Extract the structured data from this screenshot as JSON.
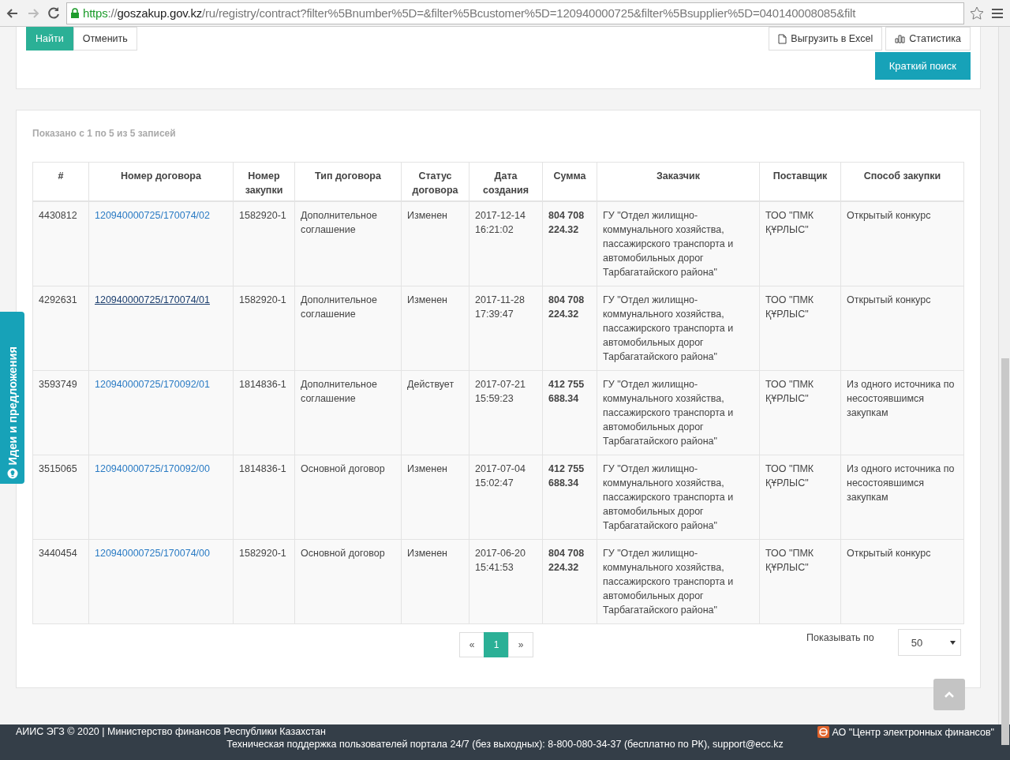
{
  "browser": {
    "url_scheme": "https",
    "url_separator": "://",
    "url_host": "goszakup.gov.kz",
    "url_path": "/ru/registry/contract?filter%5Bnumber%5D=&filter%5Bcustomer%5D=120940000725&filter%5Bsupplier%5D=040140008085&filt"
  },
  "filter_panel": {
    "buttons": [
      {
        "label": "Найти",
        "kind": "primary"
      },
      {
        "label": "Отменить",
        "kind": "default"
      }
    ],
    "right_buttons": [
      {
        "label": "Выгрузить в Excel",
        "kind": "export"
      },
      {
        "label": "Статистика",
        "kind": "stats"
      }
    ],
    "toggle_button": "Краткий поиск"
  },
  "side_tab": {
    "label": "Идеи и предложения"
  },
  "results": {
    "summary": "Показано с 1 по 5 из 5 записей",
    "columns": [
      "#",
      "Номер договора",
      "Номер закупки",
      "Тип договора",
      "Статус договора",
      "Дата создания",
      "Сумма",
      "Заказчик",
      "Поставщик",
      "Способ закупки"
    ],
    "rows": [
      {
        "id": "4430812",
        "contract": "120940000725/170074/02",
        "hovered": false,
        "purchase": "1582920-1",
        "type": "Дополнительное соглашение",
        "status": "Изменен",
        "date": "2017-12-14 16:21:02",
        "sum": "804 708 224.32",
        "customer": "ГУ \"Отдел жилищно-коммунального хозяйства, пассажирского транспорта и автомобильных дорог Тарбагатайского района\"",
        "supplier": "ТОО \"ПМК ҚҰРЛЫС\"",
        "method": "Открытый конкурс"
      },
      {
        "id": "4292631",
        "contract": "120940000725/170074/01",
        "hovered": true,
        "purchase": "1582920-1",
        "type": "Дополнительное соглашение",
        "status": "Изменен",
        "date": "2017-11-28 17:39:47",
        "sum": "804 708 224.32",
        "customer": "ГУ \"Отдел жилищно-коммунального хозяйства, пассажирского транспорта и автомобильных дорог Тарбагатайского района\"",
        "supplier": "ТОО \"ПМК ҚҰРЛЫС\"",
        "method": "Открытый конкурс"
      },
      {
        "id": "3593749",
        "contract": "120940000725/170092/01",
        "hovered": false,
        "purchase": "1814836-1",
        "type": "Дополнительное соглашение",
        "status": "Действует",
        "date": "2017-07-21 15:59:23",
        "sum": "412 755 688.34",
        "customer": "ГУ \"Отдел жилищно-коммунального хозяйства, пассажирского транспорта и автомобильных дорог Тарбагатайского района\"",
        "supplier": "ТОО \"ПМК ҚҰРЛЫС\"",
        "method": "Из одного источника по несостоявшимся закупкам"
      },
      {
        "id": "3515065",
        "contract": "120940000725/170092/00",
        "hovered": false,
        "purchase": "1814836-1",
        "type": "Основной договор",
        "status": "Изменен",
        "date": "2017-07-04 15:02:47",
        "sum": "412 755 688.34",
        "customer": "ГУ \"Отдел жилищно-коммунального хозяйства, пассажирского транспорта и автомобильных дорог Тарбагатайского района\"",
        "supplier": "ТОО \"ПМК ҚҰРЛЫС\"",
        "method": "Из одного источника по несостоявшимся закупкам"
      },
      {
        "id": "3440454",
        "contract": "120940000725/170074/00",
        "hovered": false,
        "purchase": "1582920-1",
        "type": "Основной договор",
        "status": "Изменен",
        "date": "2017-06-20 15:41:53",
        "sum": "804 708 224.32",
        "customer": "ГУ \"Отдел жилищно-коммунального хозяйства, пассажирского транспорта и автомобильных дорог Тарбагатайского района\"",
        "supplier": "ТОО \"ПМК ҚҰРЛЫС\"",
        "method": "Открытый конкурс"
      }
    ],
    "pagination": [
      {
        "label": "«",
        "selected": false
      },
      {
        "label": "1",
        "selected": true
      },
      {
        "label": "»",
        "selected": false
      }
    ],
    "page_size_label": "Показывать по",
    "page_size": "50"
  },
  "footer": {
    "left": "АИИС ЭГЗ © 2020 | Министерство финансов Республики Казахстан",
    "right": "АО \"Центр электронных финансов\"",
    "support": "Техническая поддержка пользователей портала 24/7 (без выходных): 8-800-080-34-37 (бесплатно по РК), support@ecc.kz"
  }
}
